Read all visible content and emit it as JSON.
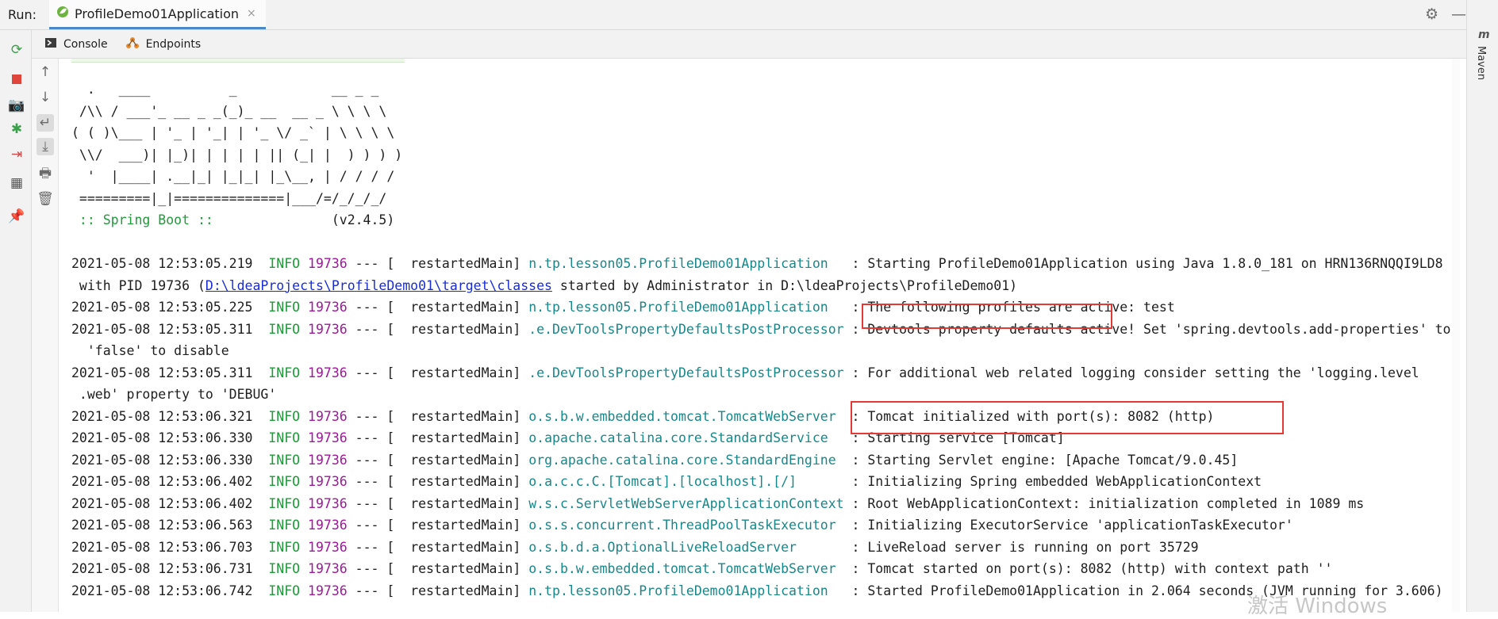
{
  "top": {
    "run_label": "Run:",
    "run_tab_label": "ProfileDemo01Application",
    "close_glyph": "×"
  },
  "subtabs": [
    {
      "label": "Console",
      "icon": "console-icon"
    },
    {
      "label": "Endpoints",
      "icon": "endpoints-icon"
    }
  ],
  "right_panel": {
    "label": "Maven",
    "icon_letter": "m"
  },
  "banner": [
    "  .   ____          _            __ _ _",
    " /\\\\ / ___'_ __ _ _(_)_ __  __ _ \\ \\ \\ \\",
    "( ( )\\___ | '_ | '_| | '_ \\/ _` | \\ \\ \\ \\",
    " \\\\/  ___)| |_)| | | | | || (_| |  ) ) ) )",
    "  '  |____| .__|_| |_|_| |_\\__, | / / / /",
    " =========|_|==============|___/=/_/_/_/"
  ],
  "spring_boot_label": " :: Spring Boot :: ",
  "spring_boot_version": "              (v2.4.5)",
  "log": [
    {
      "ts": "2021-05-08 12:53:05.219",
      "lvl": "INFO",
      "pid": "19736",
      "thread": " --- [  restartedMain] ",
      "logger": "n.tp.lesson05.ProfileDemo01Application  ",
      "msg": " : Starting ProfileDemo01Application using Java 1.8.0_181 on HRN136RNQQI9LD8"
    },
    {
      "cont_pre": " with PID 19736 (",
      "cont_link": "D:\\ldeaProjects\\ProfileDemo01\\target\\classes",
      "cont_post": " started by Administrator in D:\\ldeaProjects\\ProfileDemo01)"
    },
    {
      "ts": "2021-05-08 12:53:05.225",
      "lvl": "INFO",
      "pid": "19736",
      "thread": " --- [  restartedMain] ",
      "logger": "n.tp.lesson05.ProfileDemo01Application  ",
      "msg": " : The following profiles are active: test"
    },
    {
      "ts": "2021-05-08 12:53:05.311",
      "lvl": "INFO",
      "pid": "19736",
      "thread": " --- [  restartedMain] ",
      "logger": ".e.DevToolsPropertyDefaultsPostProcessor",
      "msg": " : Devtools property defaults active! Set 'spring.devtools.add-properties' to"
    },
    {
      "cont_pre": "  'false' to disable"
    },
    {
      "ts": "2021-05-08 12:53:05.311",
      "lvl": "INFO",
      "pid": "19736",
      "thread": " --- [  restartedMain] ",
      "logger": ".e.DevToolsPropertyDefaultsPostProcessor",
      "msg": " : For additional web related logging consider setting the 'logging.level"
    },
    {
      "cont_pre": " .web' property to 'DEBUG'"
    },
    {
      "ts": "2021-05-08 12:53:06.321",
      "lvl": "INFO",
      "pid": "19736",
      "thread": " --- [  restartedMain] ",
      "logger": "o.s.b.w.embedded.tomcat.TomcatWebServer ",
      "msg": " : Tomcat initialized with port(s): 8082 (http)"
    },
    {
      "ts": "2021-05-08 12:53:06.330",
      "lvl": "INFO",
      "pid": "19736",
      "thread": " --- [  restartedMain] ",
      "logger": "o.apache.catalina.core.StandardService  ",
      "msg": " : Starting service [Tomcat]"
    },
    {
      "ts": "2021-05-08 12:53:06.330",
      "lvl": "INFO",
      "pid": "19736",
      "thread": " --- [  restartedMain] ",
      "logger": "org.apache.catalina.core.StandardEngine ",
      "msg": " : Starting Servlet engine: [Apache Tomcat/9.0.45]"
    },
    {
      "ts": "2021-05-08 12:53:06.402",
      "lvl": "INFO",
      "pid": "19736",
      "thread": " --- [  restartedMain] ",
      "logger": "o.a.c.c.C.[Tomcat].[localhost].[/]      ",
      "msg": " : Initializing Spring embedded WebApplicationContext"
    },
    {
      "ts": "2021-05-08 12:53:06.402",
      "lvl": "INFO",
      "pid": "19736",
      "thread": " --- [  restartedMain] ",
      "logger": "w.s.c.ServletWebServerApplicationContext",
      "msg": " : Root WebApplicationContext: initialization completed in 1089 ms"
    },
    {
      "ts": "2021-05-08 12:53:06.563",
      "lvl": "INFO",
      "pid": "19736",
      "thread": " --- [  restartedMain] ",
      "logger": "o.s.s.concurrent.ThreadPoolTaskExecutor ",
      "msg": " : Initializing ExecutorService 'applicationTaskExecutor'"
    },
    {
      "ts": "2021-05-08 12:53:06.703",
      "lvl": "INFO",
      "pid": "19736",
      "thread": " --- [  restartedMain] ",
      "logger": "o.s.b.d.a.OptionalLiveReloadServer      ",
      "msg": " : LiveReload server is running on port 35729"
    },
    {
      "ts": "2021-05-08 12:53:06.731",
      "lvl": "INFO",
      "pid": "19736",
      "thread": " --- [  restartedMain] ",
      "logger": "o.s.b.w.embedded.tomcat.TomcatWebServer ",
      "msg": " : Tomcat started on port(s): 8082 (http) with context path ''"
    },
    {
      "ts": "2021-05-08 12:53:06.742",
      "lvl": "INFO",
      "pid": "19736",
      "thread": " --- [  restartedMain] ",
      "logger": "n.tp.lesson05.ProfileDemo01Application  ",
      "msg": " : Started ProfileDemo01Application in 2.064 seconds (JVM running for 3.606)"
    }
  ],
  "watermark": "激活 Windows",
  "colors": {
    "info": "#1f9b3a",
    "pid": "#a0179e",
    "logger": "#18878a",
    "highlight": "#e53935"
  }
}
